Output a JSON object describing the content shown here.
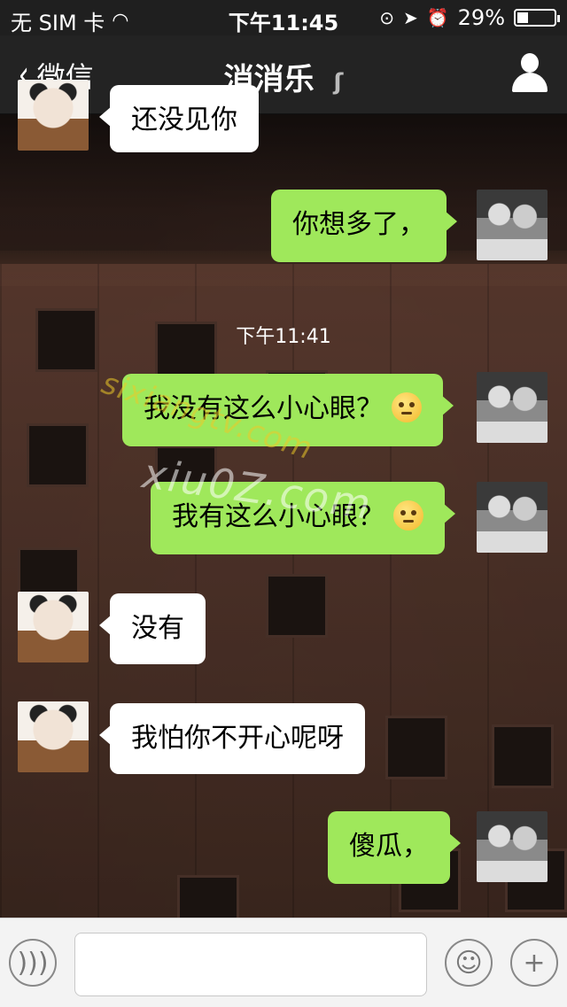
{
  "status_bar": {
    "carrier": "无 SIM 卡",
    "time": "下午11:45",
    "battery": "29%"
  },
  "nav": {
    "back_label": "微信",
    "title": "消消乐"
  },
  "timestamp": "下午11:41",
  "messages": [
    {
      "side": "left",
      "text": "还没见你"
    },
    {
      "side": "right",
      "text": "你想多了，"
    },
    {
      "side": "right",
      "text": "我没有这么小心眼？",
      "emoji": "shy-face-icon"
    },
    {
      "side": "right",
      "text": "我有这么小心眼？",
      "emoji": "shy-face-icon"
    },
    {
      "side": "left",
      "text": "没有"
    },
    {
      "side": "left",
      "text": "我怕你不开心呢呀"
    },
    {
      "side": "right",
      "text": "傻瓜，"
    }
  ],
  "watermarks": {
    "main": "xiu0Z.com",
    "secondary": "sixiangtv.com"
  },
  "icons": {
    "back": "chevron-left-icon",
    "ear": "ear-icon",
    "profile": "user-icon",
    "voice": "voice-icon",
    "emoji": "smiley-icon",
    "plus": "plus-icon"
  },
  "colors": {
    "bubble_green": "#9fe85b",
    "bubble_white": "#ffffff",
    "bar_dark": "#232323"
  }
}
